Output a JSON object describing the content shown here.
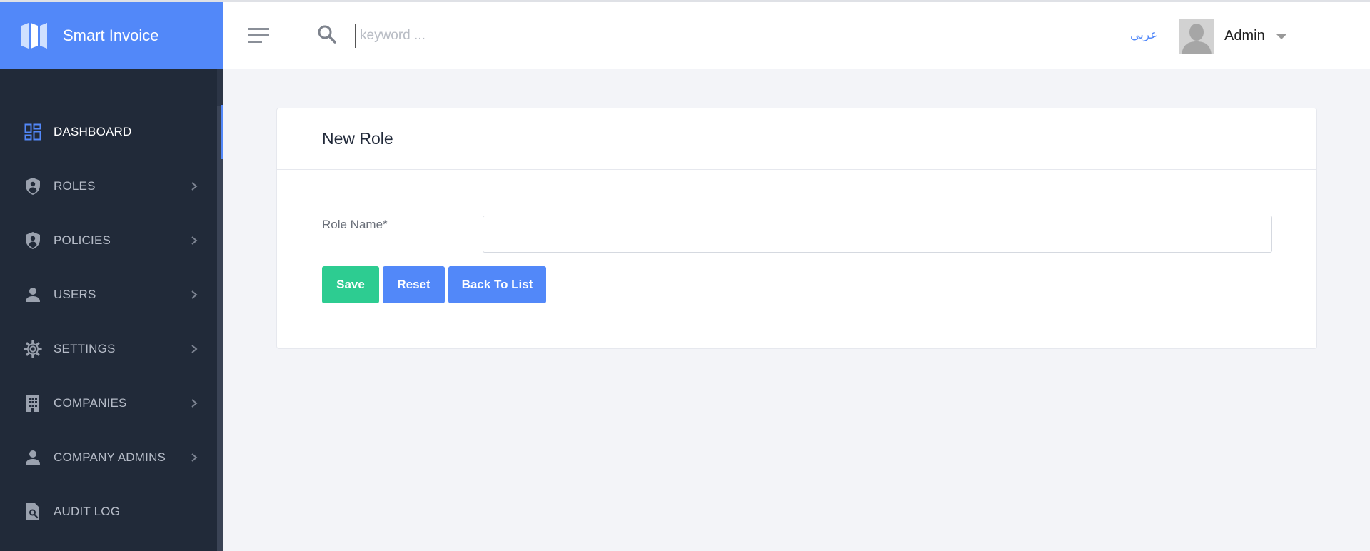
{
  "app": {
    "name": "Smart Invoice"
  },
  "header": {
    "search_placeholder": "keyword ...",
    "language_link": "عربي",
    "user_name": "Admin"
  },
  "sidebar": {
    "items": [
      {
        "label": "DASHBOARD",
        "icon": "dashboard-icon",
        "active": true,
        "has_submenu": false
      },
      {
        "label": "ROLES",
        "icon": "shield-icon",
        "active": false,
        "has_submenu": true
      },
      {
        "label": "POLICIES",
        "icon": "shield-icon",
        "active": false,
        "has_submenu": true
      },
      {
        "label": "USERS",
        "icon": "person-icon",
        "active": false,
        "has_submenu": true
      },
      {
        "label": "SETTINGS",
        "icon": "gear-icon",
        "active": false,
        "has_submenu": true
      },
      {
        "label": "COMPANIES",
        "icon": "building-icon",
        "active": false,
        "has_submenu": true
      },
      {
        "label": "COMPANY ADMINS",
        "icon": "person-icon",
        "active": false,
        "has_submenu": true
      },
      {
        "label": "AUDIT LOG",
        "icon": "document-search-icon",
        "active": false,
        "has_submenu": false
      }
    ]
  },
  "form": {
    "title": "New Role",
    "role_name_label": "Role Name*",
    "role_name_value": "",
    "save_label": "Save",
    "reset_label": "Reset",
    "back_label": "Back To List"
  },
  "colors": {
    "brand": "#5288f9",
    "sidebar_bg": "#212a39",
    "save_button": "#2dcc91",
    "primary_button": "#5288f9",
    "page_bg": "#f3f4f8"
  }
}
